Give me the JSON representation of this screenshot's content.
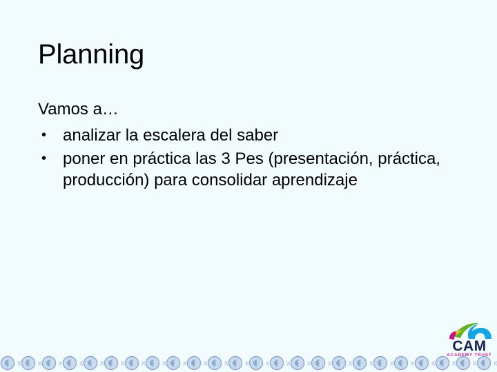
{
  "slide": {
    "background_color": "#f2fbfe",
    "title": "Planning",
    "intro": "Vamos a…",
    "bullets": [
      "analizar la escalera del saber",
      "poner en práctica las 3 Pes (presentación, práctica, producción) para consolidar aprendizaje"
    ],
    "bullet_glyph": "•"
  },
  "logo": {
    "name": "cam-academy-trust-logo",
    "primary_text": "CAM",
    "secondary_text": "ACADEMY TRUST",
    "colors": {
      "swoosh_blue": "#16a6e0",
      "swoosh_green": "#63b22e",
      "swoosh_magenta": "#c6168d",
      "swoosh_yellow": "#f2c500",
      "wordmark": "#13234a",
      "tagline": "#c6168d"
    }
  },
  "footer": {
    "decoration_name": "globe-face-pattern-strip",
    "shape_color": "#c6d8ee",
    "shape_outline": "#8fa9cd",
    "separator_glyph": "x",
    "repeat_count": 24
  }
}
